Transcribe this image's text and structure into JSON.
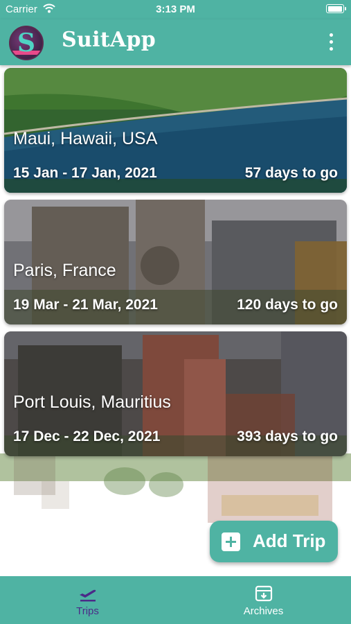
{
  "status_bar": {
    "carrier": "Carrier",
    "time": "3:13 PM",
    "battery_level": 1.0
  },
  "app_bar": {
    "title": "SuitApp",
    "logo_letter": "S",
    "menu_icon": "more-vertical-icon"
  },
  "trips": [
    {
      "place": "Maui, Hawaii, USA",
      "dates": "15 Jan - 17 Jan, 2021",
      "countdown": "57 days to go"
    },
    {
      "place": "Paris, France",
      "dates": "19 Mar - 21 Mar, 2021",
      "countdown": "120 days to go"
    },
    {
      "place": "Port Louis, Mauritius",
      "dates": "17 Dec - 22 Dec, 2021",
      "countdown": "393 days to go"
    }
  ],
  "add_trip": {
    "label": "Add Trip",
    "icon": "plus-square-icon"
  },
  "tabs": [
    {
      "label": "Trips",
      "icon": "airplane-takeoff-icon",
      "active": true
    },
    {
      "label": "Archives",
      "icon": "archive-download-icon",
      "active": false
    }
  ],
  "colors": {
    "primary": "#4fb3a3",
    "active_tab": "#4b2a88",
    "text_on_primary": "#ffffff"
  }
}
